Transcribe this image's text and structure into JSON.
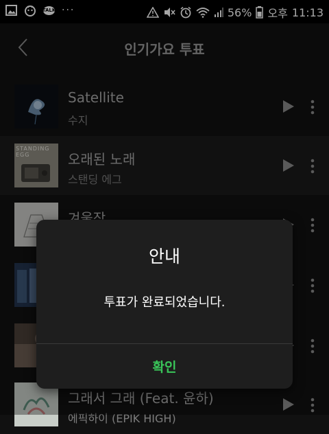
{
  "status_bar": {
    "battery_percent": "56%",
    "ampm": "오후",
    "time": "11:13",
    "left_icons": [
      "gallery-icon",
      "character-icon",
      "kakaotalk-icon",
      "more-notifications-icon"
    ],
    "right_icons": [
      "warning-icon",
      "mute-icon",
      "alarm-icon",
      "wifi-icon",
      "signal-icon",
      "battery-icon"
    ],
    "talk_text": "TALK",
    "dots_text": "···"
  },
  "header": {
    "title": "인기가요 투표",
    "back_icon": "back-chevron-icon"
  },
  "songs": [
    {
      "title": "Satellite",
      "artist": "수지"
    },
    {
      "title": "오래된 노래",
      "artist": "스탠딩 에그",
      "cover_text": "STANDING EGG"
    },
    {
      "title": "겨울잠",
      "artist": ""
    },
    {
      "title": "",
      "artist": ""
    },
    {
      "title": "",
      "artist": ""
    },
    {
      "title": "그래서 그래 (Feat. 윤하)",
      "artist": "에픽하이 (EPIK HIGH)"
    }
  ],
  "dialog": {
    "title": "안내",
    "message": "투표가 완료되었습니다.",
    "confirm_label": "확인"
  },
  "colors": {
    "accent": "#3ac75a",
    "background": "#111111",
    "dialog": "#1e1e1e"
  }
}
